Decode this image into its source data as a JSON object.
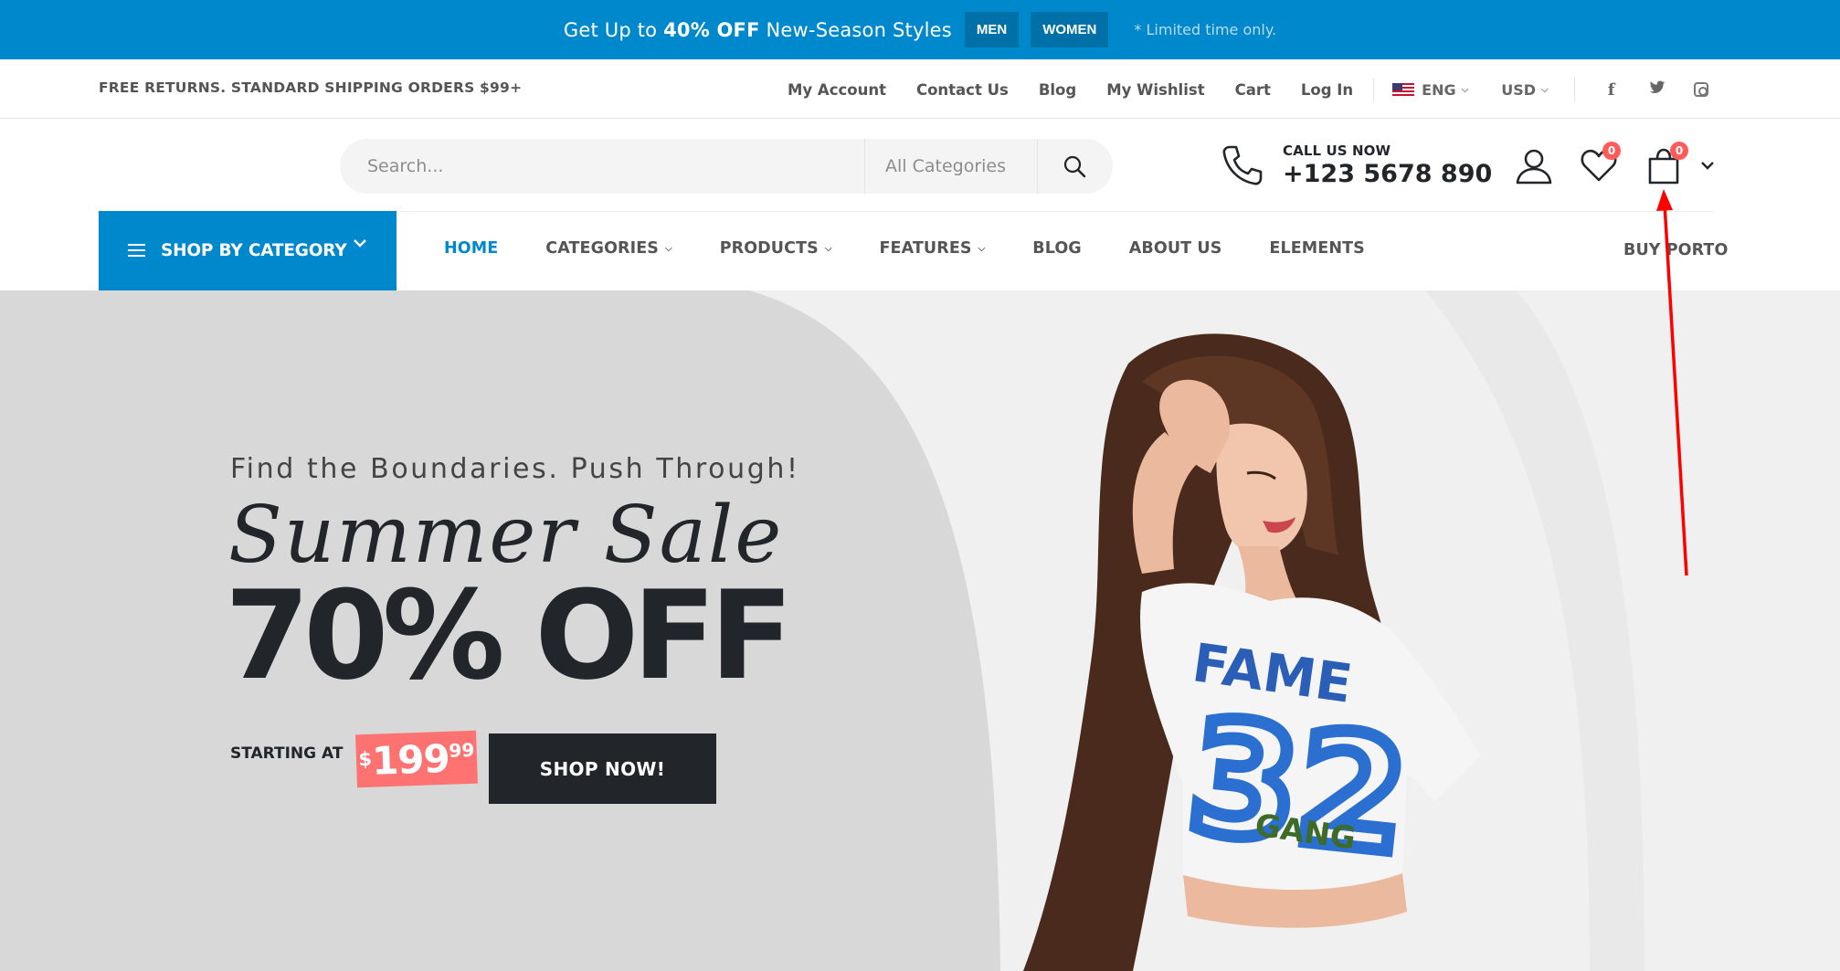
{
  "promo": {
    "text_prefix": "Get Up to ",
    "text_bold": "40% OFF",
    "text_suffix": " New-Season Styles",
    "men_label": "MEN",
    "women_label": "WOMEN",
    "note": "* Limited time only."
  },
  "topbar": {
    "shipping": "FREE RETURNS. STANDARD SHIPPING ORDERS $99+",
    "links": [
      "My Account",
      "Contact Us",
      "Blog",
      "My Wishlist",
      "Cart",
      "Log In"
    ],
    "language": "ENG",
    "currency": "USD",
    "social_icons": [
      "facebook-icon",
      "twitter-icon",
      "instagram-icon"
    ]
  },
  "header": {
    "search_placeholder": "Search...",
    "category_select": "All Categories",
    "call_label": "CALL US NOW",
    "phone": "+123 5678 890",
    "wishlist_count": "0",
    "cart_count": "0"
  },
  "nav": {
    "shop_by_category": "SHOP BY CATEGORY",
    "items": [
      {
        "label": "HOME",
        "dropdown": false
      },
      {
        "label": "CATEGORIES",
        "dropdown": true
      },
      {
        "label": "PRODUCTS",
        "dropdown": true
      },
      {
        "label": "FEATURES",
        "dropdown": true
      },
      {
        "label": "BLOG",
        "dropdown": false
      },
      {
        "label": "ABOUT US",
        "dropdown": false
      },
      {
        "label": "ELEMENTS",
        "dropdown": false
      }
    ],
    "buy": "BUY PORTO"
  },
  "hero": {
    "tagline": "Find the Boundaries. Push Through!",
    "script_title": "Summer Sale",
    "headline": "70% OFF",
    "starting_label": "STARTING AT",
    "price_currency": "$",
    "price_amount": "199",
    "price_cents": "99",
    "cta": "SHOP NOW!",
    "shirt_text_1": "FAME",
    "shirt_text_2": "32",
    "shirt_text_3": "GANG"
  },
  "colors": {
    "primary": "#0088cc",
    "dark": "#222529",
    "badge": "#ff5b5b",
    "price_tag": "#ff7272",
    "annotation": "#ff0000"
  }
}
